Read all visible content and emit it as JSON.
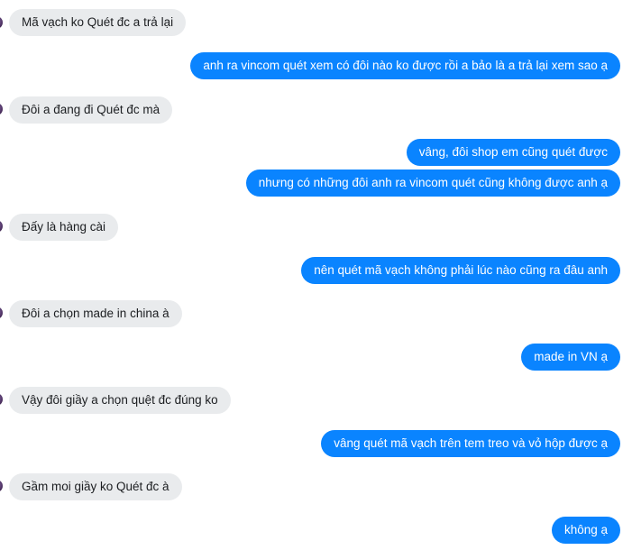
{
  "messages": [
    {
      "id": "m1",
      "side": "in",
      "text": "Mã vạch ko Quét đc a trả lại"
    },
    {
      "id": "m2",
      "side": "out",
      "text": "anh ra vincom quét xem có đôi nào ko được rồi a bảo là a trả lại xem sao ạ"
    },
    {
      "id": "m3",
      "side": "in",
      "text": "Đôi a đang đi Quét đc mà"
    },
    {
      "id": "m4",
      "side": "out",
      "text": "vâng, đôi shop em cũng quét được"
    },
    {
      "id": "m5",
      "side": "out",
      "text": "nhưng có những đôi anh ra vincom quét cũng không được anh ạ"
    },
    {
      "id": "m6",
      "side": "in",
      "text": "Đấy là hàng cài"
    },
    {
      "id": "m7",
      "side": "out",
      "text": "nên quét mã vạch không phải lúc nào cũng ra đâu anh"
    },
    {
      "id": "m8",
      "side": "in",
      "text": "Đôi a chọn made in china à"
    },
    {
      "id": "m9",
      "side": "out",
      "text": "made in VN ạ"
    },
    {
      "id": "m10",
      "side": "in",
      "text": "Vậy đôi giầy a chọn quệt đc đúng ko"
    },
    {
      "id": "m11",
      "side": "out",
      "text": "vâng quét mã vạch trên tem treo và vỏ hộp được ạ"
    },
    {
      "id": "m12",
      "side": "in",
      "text": "Gầm moi giầy ko Quét đc à"
    },
    {
      "id": "m13",
      "side": "out",
      "text": "không ạ"
    }
  ],
  "colors": {
    "incoming_bubble": "#e9ebed",
    "outgoing_bubble": "#0a84ff",
    "incoming_text": "#1c1e21",
    "outgoing_text": "#ffffff"
  }
}
